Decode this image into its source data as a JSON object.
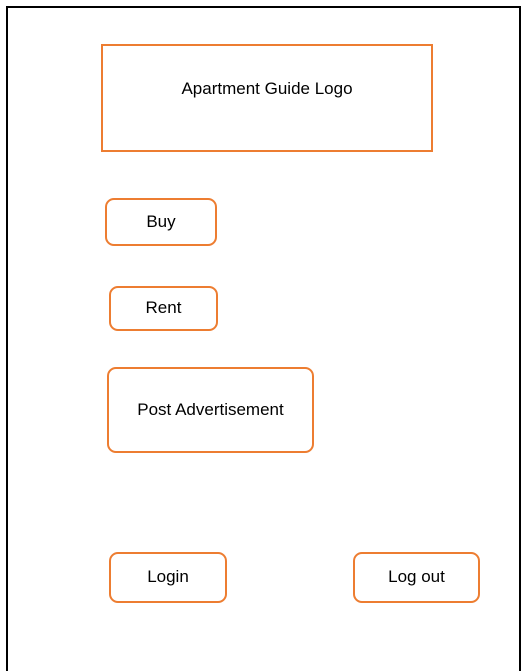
{
  "header": {
    "logo_text": "Apartment Guide Logo"
  },
  "menu": {
    "buy_label": "Buy",
    "rent_label": "Rent",
    "post_label": "Post Advertisement"
  },
  "auth": {
    "login_label": "Login",
    "logout_label": "Log out"
  },
  "colors": {
    "accent_border": "#ed7d31",
    "frame_border": "#000000"
  }
}
